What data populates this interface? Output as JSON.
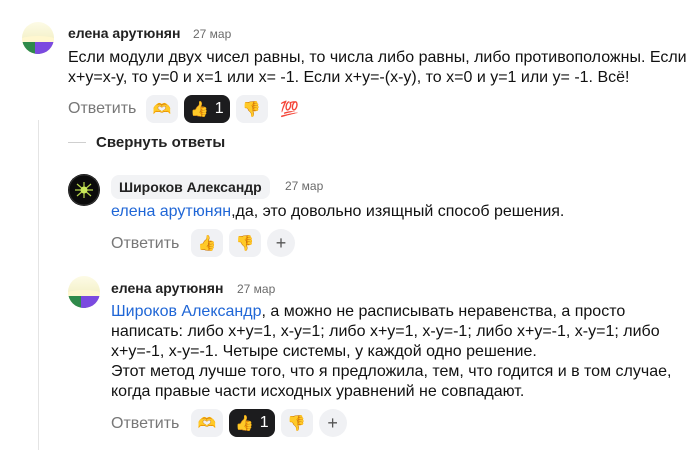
{
  "comments": [
    {
      "author": "елена арутюнян",
      "date": "27 мар",
      "text": "Если модули двух чисел равны, то числа либо равны, либо противоположны. Если x+y=x-y, то y=0 и x=1 или x= -1. Если x+y=-(x-y), то x=0 и y=1 или y= -1. Всё!",
      "reply_label": "Ответить",
      "reactions": [
        {
          "icon": "heart-face-icon",
          "emoji": "🫶"
        },
        {
          "icon": "thumbs-up-icon",
          "emoji": "👍",
          "count": "1",
          "active": true
        },
        {
          "icon": "thumbs-down-icon",
          "emoji": "👎"
        },
        {
          "icon": "hundred-icon",
          "emoji": "💯"
        }
      ]
    }
  ],
  "collapse_label": "Свернуть ответы",
  "replies": [
    {
      "author": "Широков Александр",
      "date": "27 мар",
      "mention": "елена арутюнян",
      "text": ",да, это довольно изящный способ решения.",
      "reply_label": "Ответить"
    },
    {
      "author": "елена арутюнян",
      "date": "27 мар",
      "mention": "Широков Александр",
      "text_line1": ", а можно не расписывать неравенства, а просто",
      "text_line2": "написать: либо x+y=1, x-y=1; либо x+y=1, x-y=-1; либо x+y=-1, x-y=1; либо",
      "text_line3": "x+y=-1, x-y=-1. Четыре системы, у каждой одно решение.",
      "text_line4": "Этот метод лучше того, что я предложила, тем, что годится и в том случае,",
      "text_line5": "когда правые части исходных уравнений не совпадают.",
      "reply_label": "Ответить",
      "reaction_count": "1"
    }
  ],
  "add_reaction_symbol": "+"
}
